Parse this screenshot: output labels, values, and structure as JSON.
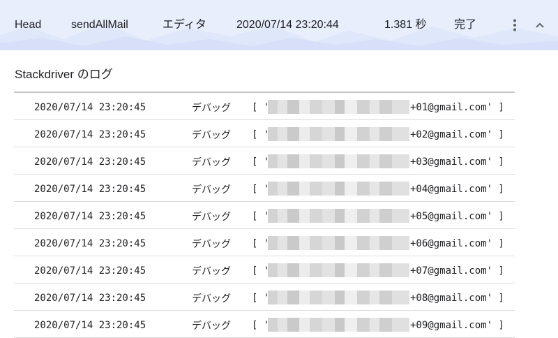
{
  "header": {
    "columns": {
      "type": "Head",
      "function": "sendAllMail",
      "trigger": "エディタ",
      "start_time": "2020/07/14 23:20:44",
      "duration": "1.381 秒",
      "status": "完了"
    },
    "more_icon": "more-vert-icon",
    "collapse_icon": "chevron-up-icon"
  },
  "logs": {
    "title": "Stackdriver のログ",
    "rows": [
      {
        "timestamp": "2020/07/14 23:20:45",
        "level": "デバッグ",
        "open": "[ '",
        "message": "+01@gmail.com' ]"
      },
      {
        "timestamp": "2020/07/14 23:20:45",
        "level": "デバッグ",
        "open": "[ '",
        "message": "+02@gmail.com' ]"
      },
      {
        "timestamp": "2020/07/14 23:20:45",
        "level": "デバッグ",
        "open": "[ '",
        "message": "+03@gmail.com' ]"
      },
      {
        "timestamp": "2020/07/14 23:20:45",
        "level": "デバッグ",
        "open": "[ '",
        "message": "+04@gmail.com' ]"
      },
      {
        "timestamp": "2020/07/14 23:20:45",
        "level": "デバッグ",
        "open": "[ '",
        "message": "+05@gmail.com' ]"
      },
      {
        "timestamp": "2020/07/14 23:20:45",
        "level": "デバッグ",
        "open": "[ '",
        "message": "+06@gmail.com' ]"
      },
      {
        "timestamp": "2020/07/14 23:20:45",
        "level": "デバッグ",
        "open": "[ '",
        "message": "+07@gmail.com' ]"
      },
      {
        "timestamp": "2020/07/14 23:20:45",
        "level": "デバッグ",
        "open": "[ '",
        "message": "+08@gmail.com' ]"
      },
      {
        "timestamp": "2020/07/14 23:20:45",
        "level": "デバッグ",
        "open": "[ '",
        "message": "+09@gmail.com' ]"
      }
    ]
  },
  "colors": {
    "header_bg": "#e8eefc",
    "rule": "#c8c8c8",
    "row_divider": "#dddddd",
    "text": "#202124"
  }
}
